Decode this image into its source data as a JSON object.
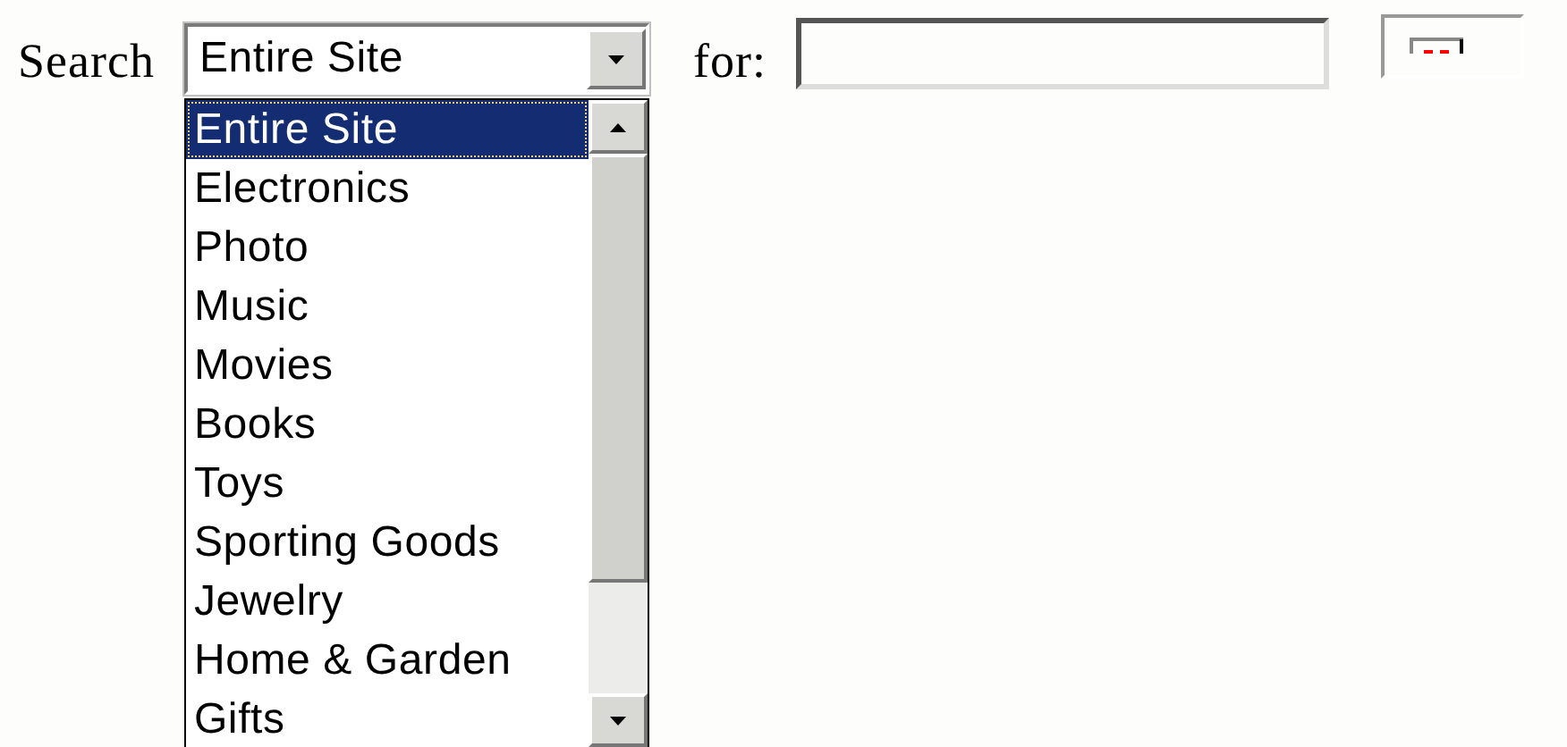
{
  "search_label": "Search",
  "category_select": {
    "value": "Entire Site"
  },
  "options": [
    {
      "label": "Entire Site",
      "selected": true
    },
    {
      "label": "Electronics",
      "selected": false
    },
    {
      "label": "Photo",
      "selected": false
    },
    {
      "label": "Music",
      "selected": false
    },
    {
      "label": "Movies",
      "selected": false
    },
    {
      "label": "Books",
      "selected": false
    },
    {
      "label": "Toys",
      "selected": false
    },
    {
      "label": "Sporting Goods",
      "selected": false
    },
    {
      "label": "Jewelry",
      "selected": false
    },
    {
      "label": "Home & Garden",
      "selected": false
    },
    {
      "label": "Gifts",
      "selected": false
    }
  ],
  "for_label": "for:"
}
